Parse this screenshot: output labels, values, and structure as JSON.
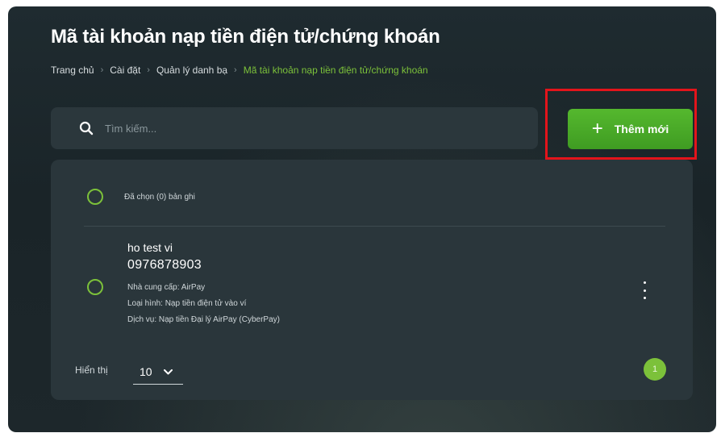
{
  "page": {
    "title": "Mã tài khoản nạp tiền điện tử/chứng khoán"
  },
  "breadcrumb": {
    "items": [
      "Trang chủ",
      "Cài đặt",
      "Quản lý danh bạ"
    ],
    "current": "Mã tài khoản nạp tiền điện tử/chứng khoán",
    "separator": "›"
  },
  "search": {
    "placeholder": "Tìm kiếm...",
    "value": ""
  },
  "add_button": {
    "label": "Thêm mới",
    "icon": "plus-icon"
  },
  "list": {
    "selected_label": "Đã chọn (0) bản ghi",
    "items": [
      {
        "name": "ho test vi",
        "account": "0976878903",
        "provider": "Nhà cung cấp: AirPay",
        "type": "Loại hình: Nạp tiền điện tử vào ví",
        "service": "Dịch vụ: Nạp tiền Đại lý AirPay (CyberPay)"
      }
    ]
  },
  "pagination": {
    "page_size_label": "Hiển thị",
    "page_size_value": "10",
    "current_page": "1"
  },
  "colors": {
    "accent": "#7cc13a",
    "button": "#4cae2a",
    "highlight": "#e3141b",
    "background": "#1c272b"
  }
}
